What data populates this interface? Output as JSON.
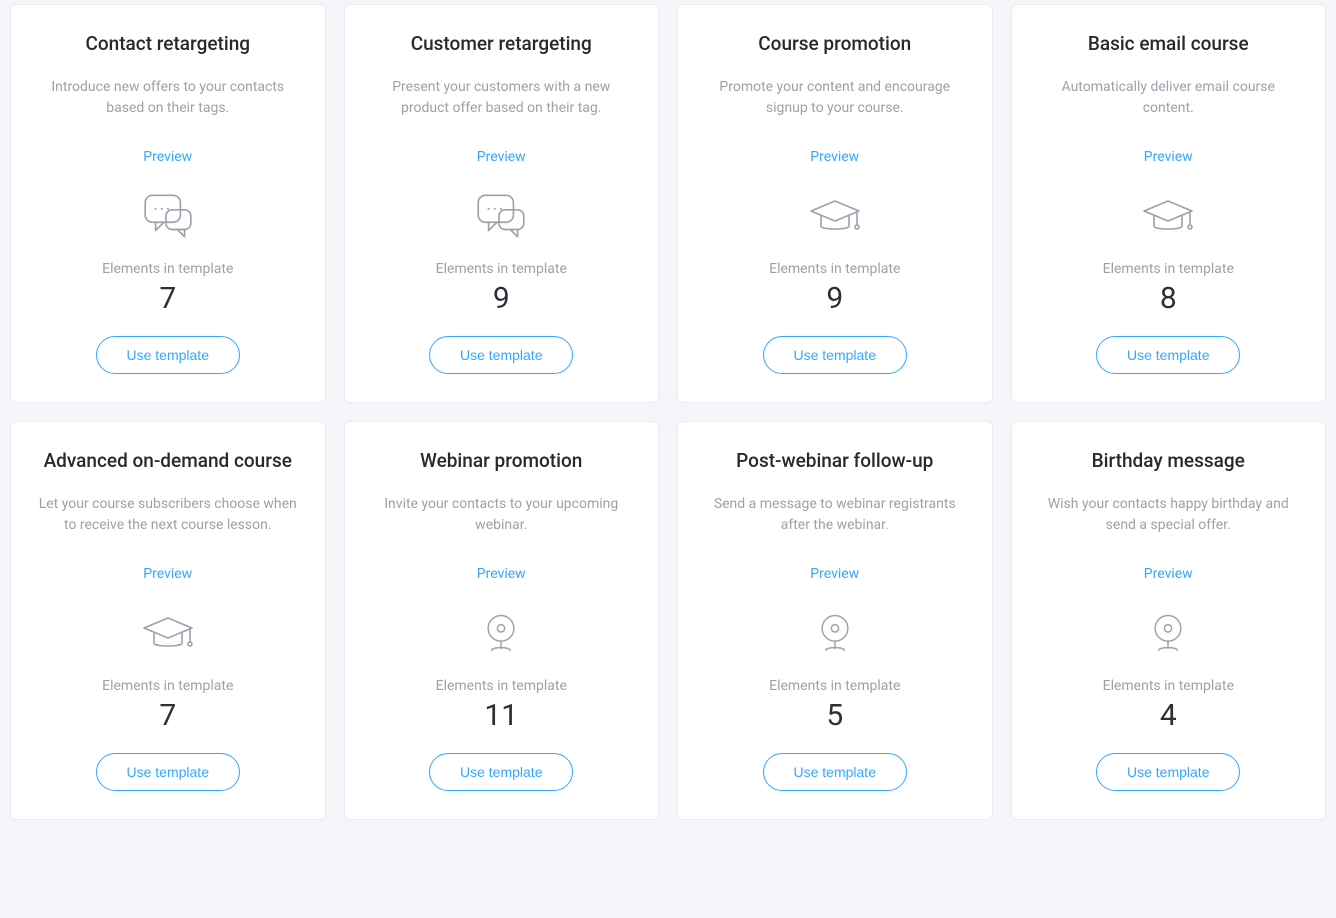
{
  "labels": {
    "preview": "Preview",
    "elements_in_template": "Elements in template",
    "use_template": "Use template"
  },
  "icons": {
    "chat": "chat-bubbles-icon",
    "grad": "graduation-cap-icon",
    "webcam": "webcam-icon"
  },
  "cards": [
    {
      "title": "Contact retargeting",
      "description": "Introduce new offers to your contacts based on their tags.",
      "icon": "chat",
      "elements": 7
    },
    {
      "title": "Customer retargeting",
      "description": "Present your customers with a new product offer based on their tag.",
      "icon": "chat",
      "elements": 9
    },
    {
      "title": "Course promotion",
      "description": "Promote your content and encourage signup to your course.",
      "icon": "grad",
      "elements": 9
    },
    {
      "title": "Basic email course",
      "description": "Automatically deliver email course content.",
      "icon": "grad",
      "elements": 8
    },
    {
      "title": "Advanced on-demand course",
      "description": "Let your course subscribers choose when to receive the next course lesson.",
      "icon": "grad",
      "elements": 7
    },
    {
      "title": "Webinar promotion",
      "description": "Invite your contacts to your upcoming webinar.",
      "icon": "webcam",
      "elements": 11
    },
    {
      "title": "Post-webinar follow-up",
      "description": "Send a message to webinar registrants after the webinar.",
      "icon": "webcam",
      "elements": 5
    },
    {
      "title": "Birthday message",
      "description": "Wish your contacts happy birthday and send a special offer.",
      "icon": "webcam",
      "elements": 4
    }
  ]
}
